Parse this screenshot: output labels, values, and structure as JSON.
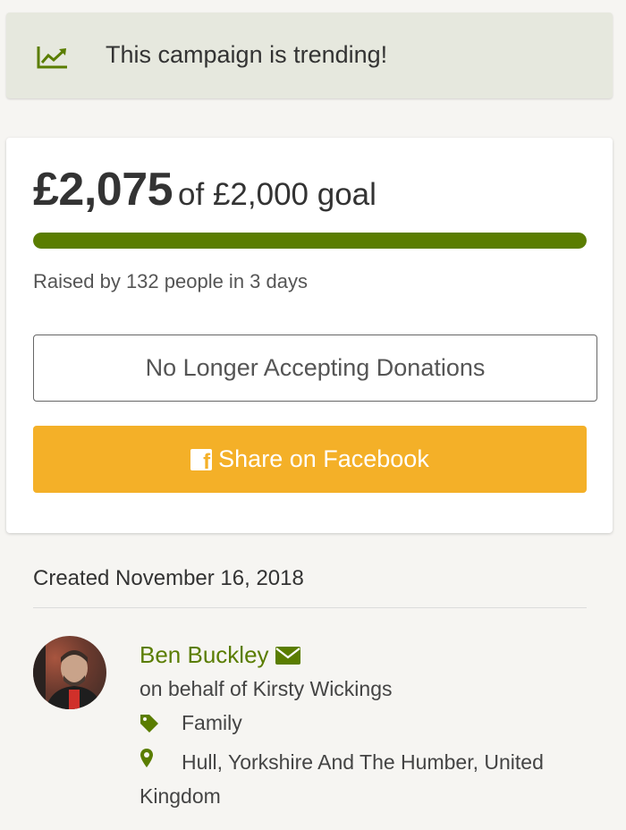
{
  "trending": {
    "icon": "trending-chart-icon",
    "text": "This campaign is trending!"
  },
  "fundraiser": {
    "amount_raised": "£2,075",
    "goal_text": "of £2,000 goal",
    "progress_percent": 100,
    "raised_by_text": "Raised by 132 people in 3 days",
    "status_button_label": "No Longer Accepting Donations",
    "share_button_label": "Share on Facebook",
    "share_icon": "facebook-icon"
  },
  "details": {
    "created_text": "Created November 16, 2018"
  },
  "organizer": {
    "name": "Ben Buckley",
    "behalf_text": "on behalf of Kirsty Wickings",
    "category": "Family",
    "location": "Hull, Yorkshire And The Humber, United Kingdom"
  },
  "colors": {
    "accent_green": "#5a7d00",
    "share_orange": "#f4b028",
    "trending_bg": "#e6e8de",
    "page_bg": "#f6f5f2"
  }
}
